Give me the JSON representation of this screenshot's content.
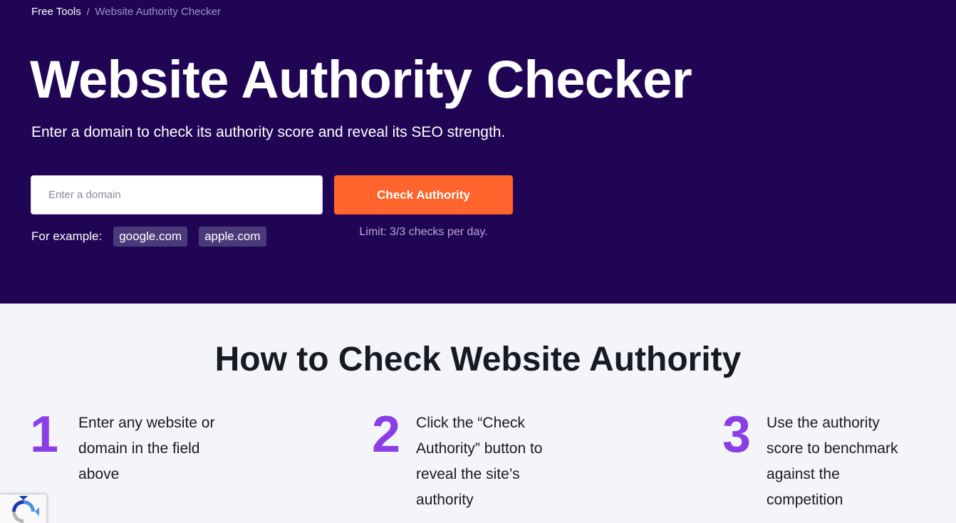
{
  "breadcrumb": {
    "home": "Free Tools",
    "separator": "/",
    "current": "Website Authority Checker"
  },
  "hero": {
    "title": "Website Authority Checker",
    "subtitle": "Enter a domain to check its authority score and reveal its SEO strength.",
    "input_placeholder": "Enter a domain",
    "input_value": "",
    "button_label": "Check Authority",
    "examples_label": "For example:",
    "examples": [
      "google.com",
      "apple.com"
    ],
    "limit_text": "Limit: 3/3 checks per day."
  },
  "how_to": {
    "title": "How to Check Website Authority",
    "steps": [
      {
        "number": "1",
        "text": "Enter any website or domain in the field above"
      },
      {
        "number": "2",
        "text": "Click the “Check Authority” button to reveal the site’s authority"
      },
      {
        "number": "3",
        "text": "Use the authority score to benchmark against the competition"
      }
    ]
  },
  "icons": {
    "recaptcha": "recaptcha-icon"
  },
  "colors": {
    "hero_bg": "#200555",
    "accent_button": "#ff642d",
    "step_number": "#8a3ee6",
    "chip_bg": "#4b3a7a",
    "page_bg": "#f4f5f9"
  }
}
